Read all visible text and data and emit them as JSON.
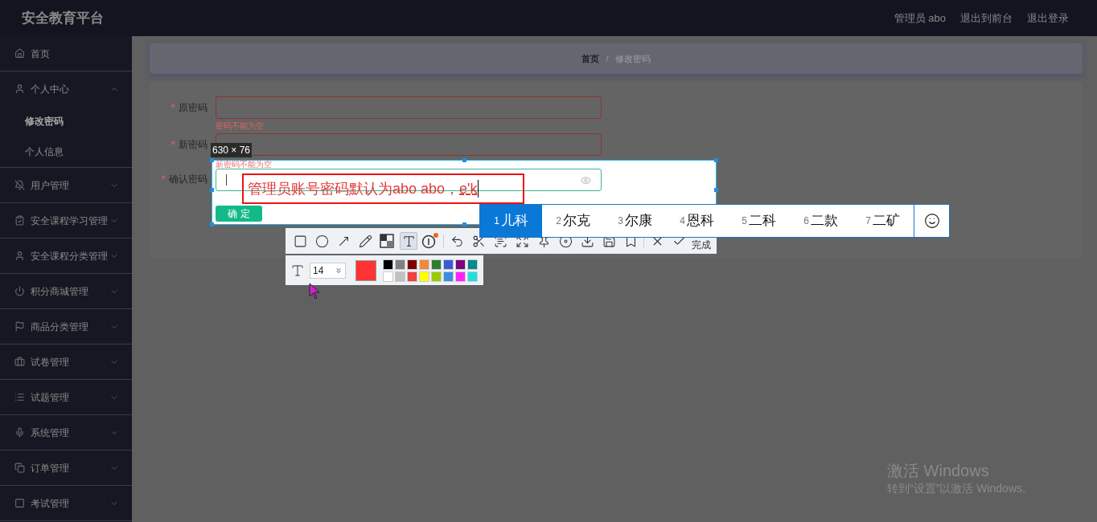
{
  "header": {
    "title": "安全教育平台",
    "user": "管理员 abo",
    "links": [
      "退出到前台",
      "退出登录"
    ]
  },
  "sidebar": {
    "items": [
      {
        "label": "首页"
      },
      {
        "label": "个人中心",
        "expanded": true,
        "children": [
          {
            "label": "修改密码",
            "selected": true
          },
          {
            "label": "个人信息",
            "selected": false
          }
        ]
      },
      {
        "label": "用户管理",
        "expanded": false
      },
      {
        "label": "安全课程学习管理",
        "expanded": false
      },
      {
        "label": "安全课程分类管理",
        "expanded": false
      },
      {
        "label": "积分商城管理",
        "expanded": false
      },
      {
        "label": "商品分类管理",
        "expanded": false
      },
      {
        "label": "试卷管理",
        "expanded": false
      },
      {
        "label": "试题管理",
        "expanded": false
      },
      {
        "label": "系统管理",
        "expanded": false
      },
      {
        "label": "订单管理",
        "expanded": false
      },
      {
        "label": "考试管理",
        "expanded": false
      }
    ]
  },
  "breadcrumb": {
    "separator": "/",
    "items": [
      {
        "label": "首页",
        "current": false
      },
      {
        "label": "修改密码",
        "current": true
      }
    ]
  },
  "form": {
    "fields": [
      {
        "label": "原密码",
        "required_mark": "*",
        "focused": false,
        "error": "密码不能为空"
      },
      {
        "label": "新密码",
        "required_mark": "*",
        "focused": false,
        "error": "新密码不能为空"
      },
      {
        "label": "确认密码",
        "required_mark": "*",
        "focused": true,
        "password_toggle": true
      }
    ],
    "submit": "确 定"
  },
  "screenshot_tool": {
    "size": "630 × 76",
    "annotation": {
      "text": "管理员账号密码默认为abo abo，",
      "composing": "e'k"
    },
    "tool_groups": [
      [
        {
          "kind": "rectangle",
          "selected": false
        },
        {
          "kind": "ellipse",
          "selected": false
        },
        {
          "kind": "arrow",
          "selected": false
        },
        {
          "kind": "pencil",
          "selected": false
        },
        {
          "kind": "mosaic",
          "selected": false
        },
        {
          "kind": "text",
          "selected": true
        },
        {
          "kind": "number",
          "selected": false
        }
      ],
      [
        {
          "kind": "undo",
          "selected": false
        },
        {
          "kind": "cut",
          "selected": false
        },
        {
          "kind": "ocr",
          "selected": false
        },
        {
          "kind": "expand",
          "selected": false
        },
        {
          "kind": "pin",
          "selected": false
        },
        {
          "kind": "record",
          "selected": false
        },
        {
          "kind": "download",
          "selected": false
        },
        {
          "kind": "save",
          "selected": false
        },
        {
          "kind": "bookmark",
          "selected": false
        }
      ],
      [
        {
          "kind": "cancel",
          "selected": false
        },
        {
          "kind": "confirm",
          "selected": false
        }
      ]
    ],
    "done": "完成",
    "text_options": {
      "font_size": "14",
      "color": "#ff3333",
      "palette": [
        {
          "color": "#000000"
        },
        {
          "color": "#808080"
        },
        {
          "color": "#800000"
        },
        {
          "color": "#f08a3a"
        },
        {
          "color": "#2e7d32"
        },
        {
          "color": "#3b5bd6"
        },
        {
          "color": "#800080"
        },
        {
          "color": "#008b8b"
        },
        {
          "color": "#ffffff"
        },
        {
          "color": "#c0c0c0"
        },
        {
          "color": "#f04040"
        },
        {
          "color": "#ffff00"
        },
        {
          "color": "#99cc00"
        },
        {
          "color": "#3b8de0"
        },
        {
          "color": "#ff22ff"
        },
        {
          "color": "#22dddd"
        }
      ]
    }
  },
  "ime": {
    "candidates": [
      {
        "number": "1",
        "text": "儿科",
        "selected": true
      },
      {
        "number": "2",
        "text": "尔克",
        "selected": false
      },
      {
        "number": "3",
        "text": "尔康",
        "selected": false
      },
      {
        "number": "4",
        "text": "恩科",
        "selected": false
      },
      {
        "number": "5",
        "text": "二科",
        "selected": false
      },
      {
        "number": "6",
        "text": "二款",
        "selected": false
      },
      {
        "number": "7",
        "text": "二矿",
        "selected": false
      }
    ]
  },
  "os_notice": {
    "title": "激活 Windows",
    "text": "转到“设置”以激活 Windows。"
  }
}
